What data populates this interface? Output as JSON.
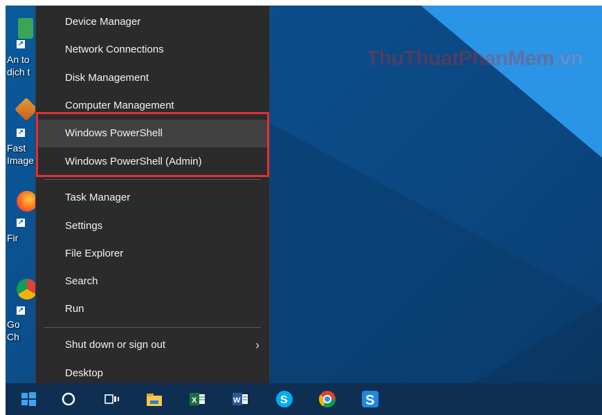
{
  "watermark": {
    "part1": "ThuThuat",
    "part2": "PhanMem",
    "part3": ".vn"
  },
  "desktop_icons": [
    {
      "label_line1": "An to",
      "label_line2": "dịch t",
      "icon": "security-app-icon"
    },
    {
      "label_line1": "Fast",
      "label_line2": "Image",
      "icon": "faststone-image-icon"
    },
    {
      "label_line1": "Fir",
      "label_line2": "",
      "icon": "firefox-icon"
    },
    {
      "label_line1": "Go",
      "label_line2": "Ch",
      "icon": "chrome-icon"
    }
  ],
  "menu": {
    "group1": [
      {
        "label": "Device Manager"
      },
      {
        "label": "Network Connections"
      },
      {
        "label": "Disk Management"
      },
      {
        "label": "Computer Management"
      },
      {
        "label": "Windows PowerShell",
        "hovered": true
      },
      {
        "label": "Windows PowerShell (Admin)"
      }
    ],
    "group2": [
      {
        "label": "Task Manager"
      },
      {
        "label": "Settings"
      },
      {
        "label": "File Explorer"
      },
      {
        "label": "Search"
      },
      {
        "label": "Run"
      }
    ],
    "group3": [
      {
        "label": "Shut down or sign out",
        "has_submenu": true,
        "submenu_icon": "chevron-right-icon"
      },
      {
        "label": "Desktop"
      }
    ],
    "highlight_color": "#e0303a"
  },
  "taskbar": {
    "icons": [
      "windows-start-icon",
      "cortana-icon",
      "task-view-icon",
      "file-explorer-icon",
      "excel-icon",
      "word-icon",
      "skype-icon",
      "chrome-icon",
      "snagit-icon"
    ]
  },
  "colors": {
    "menu_bg": "#2b2b2b",
    "menu_text": "#f2f2f2",
    "accent_blue": "#1e8fe0"
  }
}
